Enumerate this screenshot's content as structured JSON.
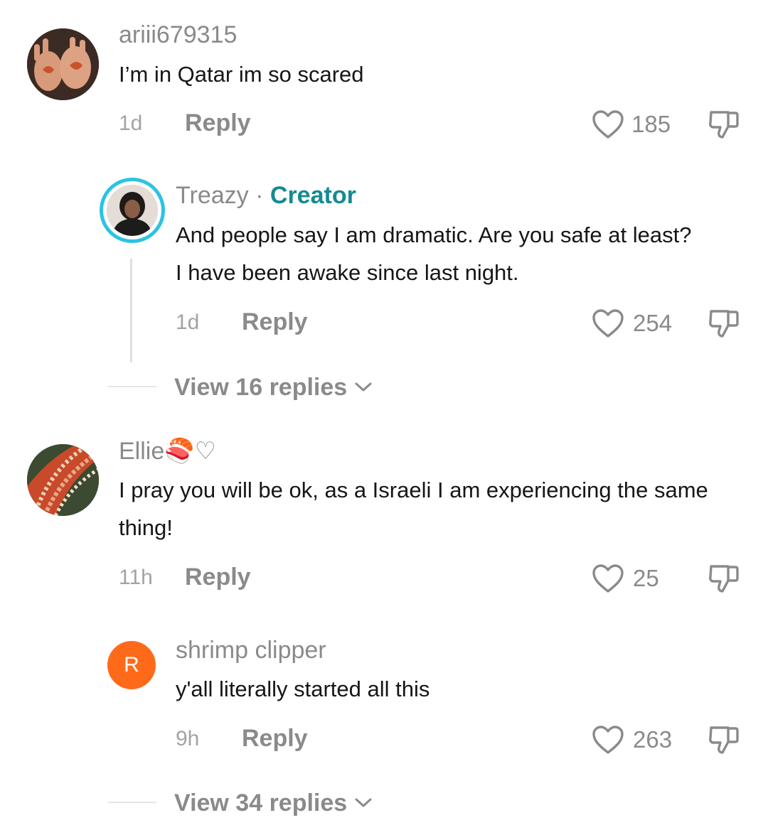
{
  "comments": [
    {
      "username": "ariii679315",
      "text": "I’m in Qatar im so scared",
      "time": "1d",
      "reply_label": "Reply",
      "likes": "185"
    },
    {
      "username": "Treazy",
      "separator": "·",
      "badge": "Creator",
      "text": "And people say I am dramatic. Are you safe at least? I have been awake since last night.",
      "time": "1d",
      "reply_label": "Reply",
      "likes": "254"
    },
    {
      "username": "Ellie",
      "username_suffix": "🍣♡",
      "text": "I pray you will be ok, as a Israeli I am experiencing the same thing!",
      "time": "11h",
      "reply_label": "Reply",
      "likes": "25"
    },
    {
      "username": "shrimp clipper",
      "avatar_initial": "R",
      "text": "y'all literally started all this",
      "time": "9h",
      "reply_label": "Reply",
      "likes": "263"
    }
  ],
  "view_replies": [
    {
      "label": "View 16 replies"
    },
    {
      "label": "View 34 replies"
    }
  ],
  "colors": {
    "creator_badge": "#148a93",
    "avatar_ring": "#2bc3e3",
    "initial_avatar": "#ff6a1a"
  },
  "icons": [
    "heart-icon",
    "dislike-icon",
    "chevron-down-icon"
  ]
}
